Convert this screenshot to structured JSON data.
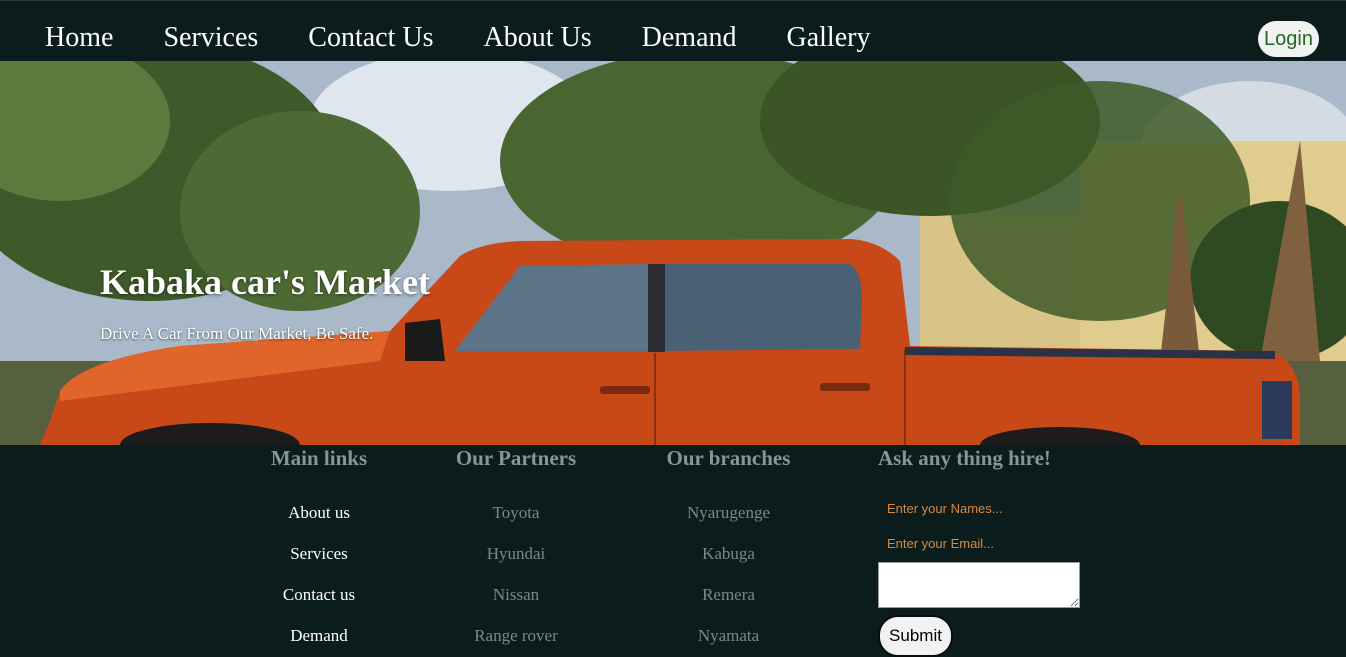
{
  "nav": {
    "links": [
      "Home",
      "Services",
      "Contact Us",
      "About Us",
      "Demand",
      "Gallery"
    ],
    "login_label": "Login"
  },
  "hero": {
    "title": "Kabaka car's Market",
    "subtitle": "Drive A Car From Our Market, Be Safe."
  },
  "footer": {
    "main_links": {
      "heading": "Main links",
      "items": [
        "About us",
        "Services",
        "Contact us",
        "Demand"
      ]
    },
    "partners": {
      "heading": "Our Partners",
      "items": [
        "Toyota",
        "Hyundai",
        "Nissan",
        "Range rover"
      ]
    },
    "branches": {
      "heading": "Our branches",
      "items": [
        "Nyarugenge",
        "Kabuga",
        "Remera",
        "Nyamata"
      ]
    },
    "ask": {
      "heading": "Ask any thing hire!",
      "names_placeholder": "Enter your Names...",
      "email_placeholder": "Enter your Email...",
      "submit_label": "Submit"
    }
  },
  "colors": {
    "background": "#0b1c1c",
    "nav_text": "#ffffff",
    "login_text": "#1e6b1e",
    "footer_heading": "#8a9494",
    "placeholder": "#d98a3a",
    "truck": "#d2501e"
  }
}
